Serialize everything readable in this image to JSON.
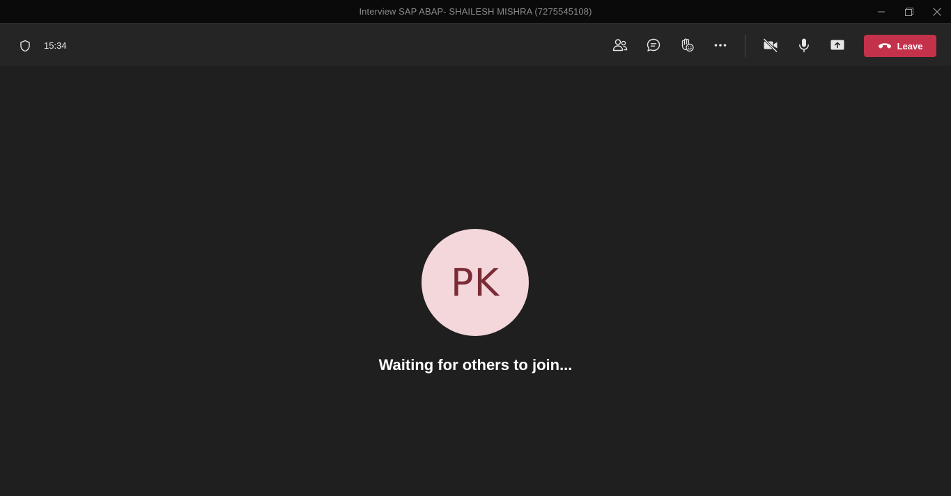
{
  "window": {
    "title": "Interview SAP ABAP- SHAILESH MISHRA (7275545108)",
    "controls": [
      "minimize-icon",
      "restore-icon",
      "close-icon"
    ]
  },
  "toolbar": {
    "meeting_timer": "15:34",
    "icons": [
      "shield-icon",
      "participants-icon",
      "chat-icon",
      "reactions-icon",
      "more-icon",
      "camera-off-icon",
      "microphone-icon",
      "share-screen-icon"
    ],
    "leave_label": "Leave",
    "leave_color": "#c4314b"
  },
  "stage": {
    "avatar_initials": "PK",
    "avatar_bg": "#f4d7da",
    "avatar_fg": "#7a2c36",
    "status_text": "Waiting for others to join..."
  }
}
